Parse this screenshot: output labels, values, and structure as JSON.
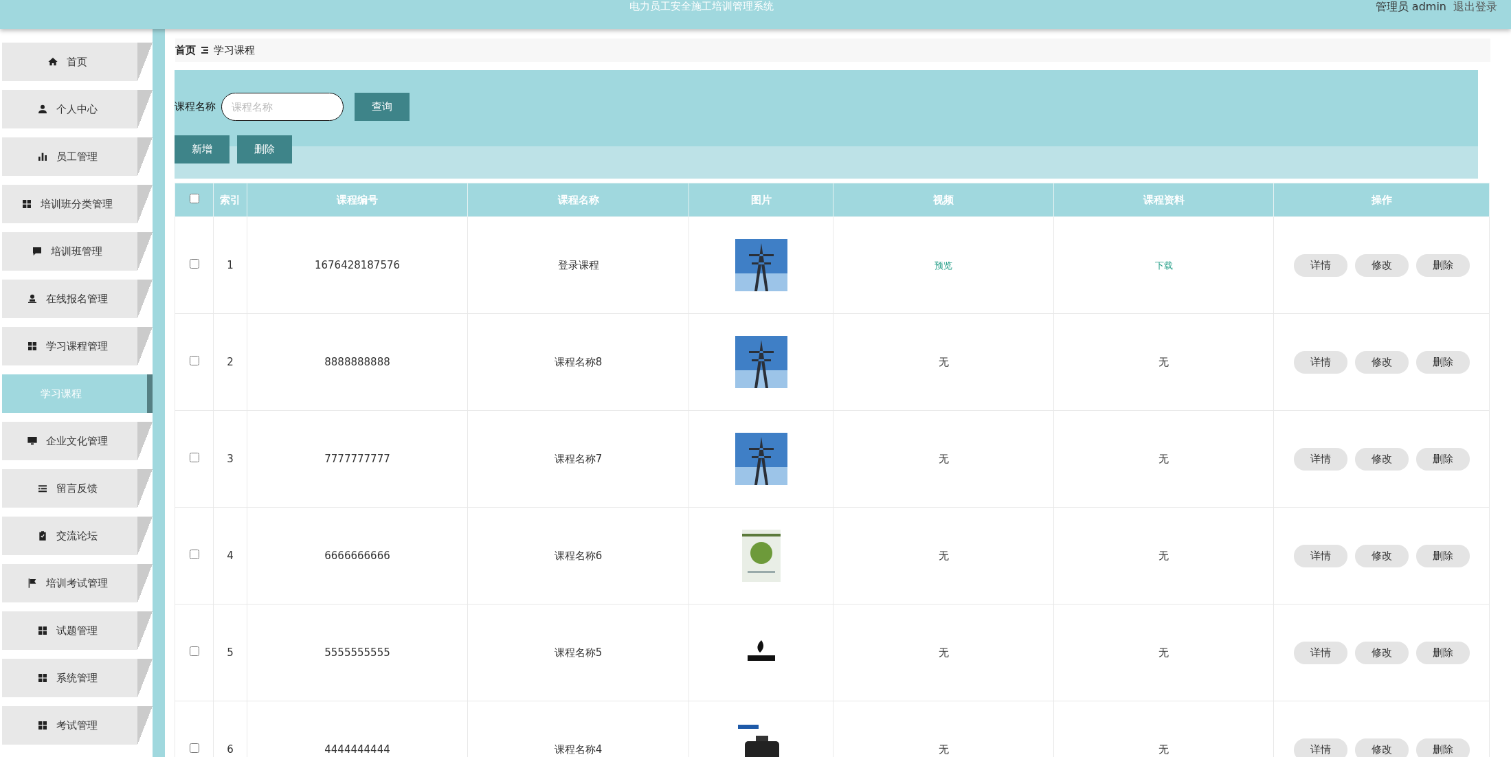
{
  "header": {
    "title": "电力员工安全施工培训管理系统",
    "user": "管理员 admin",
    "logout": "退出登录"
  },
  "sidebar": {
    "items": [
      {
        "label": "首页",
        "selected": false
      },
      {
        "label": "个人中心",
        "selected": false
      },
      {
        "label": "员工管理",
        "selected": false
      },
      {
        "label": "培训班分类管理",
        "selected": false
      },
      {
        "label": "培训班管理",
        "selected": false
      },
      {
        "label": "在线报名管理",
        "selected": false
      },
      {
        "label": "学习课程管理",
        "selected": false,
        "children": [
          {
            "label": "学习课程",
            "selected": true
          }
        ]
      },
      {
        "label": "企业文化管理",
        "selected": false
      },
      {
        "label": "留言反馈",
        "selected": false
      },
      {
        "label": "交流论坛",
        "selected": false
      },
      {
        "label": "培训考试管理",
        "selected": false
      },
      {
        "label": "试题管理",
        "selected": false
      },
      {
        "label": "系统管理",
        "selected": false
      },
      {
        "label": "考试管理",
        "selected": false
      }
    ]
  },
  "breadcrumb": [
    "首页",
    "学习课程"
  ],
  "search": {
    "label": "课程名称",
    "placeholder": "课程名称",
    "button": "查询"
  },
  "toolbar": [
    "新增",
    "删除"
  ],
  "table": {
    "all_checked": false,
    "columns": [
      "索引",
      "课程编号",
      "课程名称",
      "图片",
      "视频",
      "课程资料",
      "操作"
    ],
    "rows": [
      {
        "checked": false,
        "index": "1",
        "code": "1676428187576",
        "name": "登录课程",
        "video": {
          "kind": "link",
          "text": "预览"
        },
        "material": {
          "kind": "link",
          "text": "下载"
        },
        "actions": [
          "详情",
          "修改",
          "删除"
        ]
      },
      {
        "checked": false,
        "index": "2",
        "code": "8888888888",
        "name": "课程名称8",
        "video": {
          "kind": "text",
          "text": "无"
        },
        "material": {
          "kind": "text",
          "text": "无"
        },
        "actions": [
          "详情",
          "修改",
          "删除"
        ]
      },
      {
        "checked": false,
        "index": "3",
        "code": "7777777777",
        "name": "课程名称7",
        "video": {
          "kind": "text",
          "text": "无"
        },
        "material": {
          "kind": "text",
          "text": "无"
        },
        "actions": [
          "详情",
          "修改",
          "删除"
        ]
      },
      {
        "checked": false,
        "index": "4",
        "code": "6666666666",
        "name": "课程名称6",
        "video": {
          "kind": "text",
          "text": "无"
        },
        "material": {
          "kind": "text",
          "text": "无"
        },
        "actions": [
          "详情",
          "修改",
          "删除"
        ]
      },
      {
        "checked": false,
        "index": "5",
        "code": "5555555555",
        "name": "课程名称5",
        "video": {
          "kind": "text",
          "text": "无"
        },
        "material": {
          "kind": "text",
          "text": "无"
        },
        "actions": [
          "详情",
          "修改",
          "删除"
        ]
      },
      {
        "checked": false,
        "index": "6",
        "code": "4444444444",
        "name": "课程名称4",
        "video": {
          "kind": "text",
          "text": "无"
        },
        "material": {
          "kind": "text",
          "text": "无"
        },
        "actions": [
          "详情",
          "修改",
          "删除"
        ]
      }
    ]
  }
}
